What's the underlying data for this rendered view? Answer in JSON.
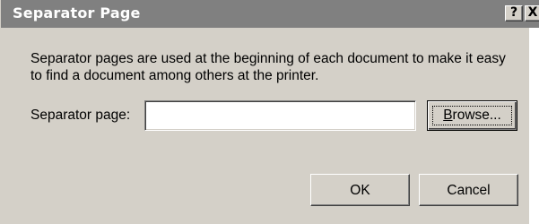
{
  "window": {
    "title": "Separator Page",
    "help_glyph": "?",
    "close_glyph": "X"
  },
  "description": "Separator pages are used at the beginning of each document to make it easy to find a document among others at the printer.",
  "separator_field": {
    "label": "Separator page:",
    "value": "",
    "placeholder": ""
  },
  "buttons": {
    "browse_mnemonic": "B",
    "browse_rest": "rowse...",
    "ok": "OK",
    "cancel": "Cancel"
  },
  "colors": {
    "titlebar_inactive": "#808080",
    "face": "#d4d0c8"
  }
}
